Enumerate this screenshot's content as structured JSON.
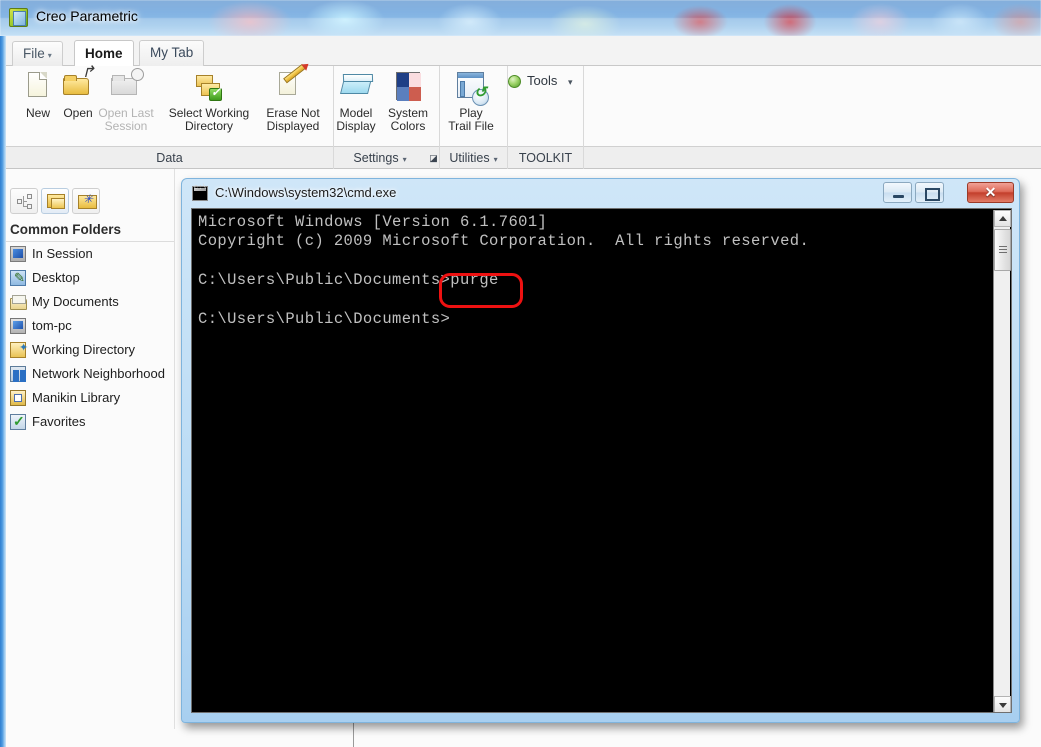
{
  "desktop": {
    "app_window_title": "Creo Parametric",
    "app_icon_name": "creo-app-icon"
  },
  "ribbon": {
    "tabs": [
      {
        "label": "File",
        "caret": "▾",
        "name": "file"
      },
      {
        "label": "Home",
        "name": "home"
      },
      {
        "label": "My Tab",
        "name": "my-tab"
      }
    ],
    "buttons": [
      {
        "label_line1": "New",
        "label_line2": "",
        "icon": "new-document-icon",
        "disabled": false
      },
      {
        "label_line1": "Open",
        "label_line2": "",
        "icon": "open-folder-icon",
        "disabled": false
      },
      {
        "label_line1": "Open Last",
        "label_line2": "Session",
        "icon": "open-last-session-icon",
        "disabled": true
      },
      {
        "label_line1": "Select Working",
        "label_line2": "Directory",
        "icon": "select-working-directory-icon",
        "disabled": false
      },
      {
        "label_line1": "Erase Not",
        "label_line2": "Displayed",
        "icon": "erase-not-displayed-icon",
        "disabled": false
      },
      {
        "label_line1": "Model",
        "label_line2": "Display",
        "icon": "model-display-icon",
        "disabled": false
      },
      {
        "label_line1": "System",
        "label_line2": "Colors",
        "icon": "system-colors-icon",
        "disabled": false
      },
      {
        "label_line1": "Play",
        "label_line2": "Trail File",
        "icon": "play-trail-file-icon",
        "disabled": false
      }
    ],
    "tools_button": {
      "label": "Tools",
      "caret": "▾",
      "icon": "tools-orb-icon"
    },
    "groups": [
      {
        "label": "Data",
        "caret": ""
      },
      {
        "label": "Settings",
        "caret": "▾"
      },
      {
        "label": "Utilities",
        "caret": "▾"
      },
      {
        "label": "TOOLKIT",
        "caret": ""
      }
    ],
    "dialog_launcher": "◪"
  },
  "navigator": {
    "toolbar_buttons": [
      {
        "name": "model-tree-button",
        "icon": "model-tree-icon",
        "active": false
      },
      {
        "name": "folder-browser-button",
        "icon": "folders-icon",
        "active": true
      },
      {
        "name": "favorites-button",
        "icon": "folder-star-icon",
        "active": false
      }
    ],
    "header": "Common Folders",
    "items": [
      {
        "label": "In Session",
        "icon": "in-session-icon"
      },
      {
        "label": "Desktop",
        "icon": "desktop-icon"
      },
      {
        "label": "My Documents",
        "icon": "my-documents-icon"
      },
      {
        "label": "tom-pc",
        "icon": "computer-icon"
      },
      {
        "label": "Working Directory",
        "icon": "working-directory-icon"
      },
      {
        "label": "Network Neighborhood",
        "icon": "network-icon"
      },
      {
        "label": "Manikin Library",
        "icon": "manikin-library-icon"
      },
      {
        "label": "Favorites",
        "icon": "favorites-icon"
      }
    ]
  },
  "cmd_window": {
    "title": "C:\\Windows\\system32\\cmd.exe",
    "icon": "cmd-console-icon",
    "window_buttons": {
      "minimize": "minimize-button",
      "maximize": "maximize-button",
      "close": "close-button"
    },
    "console_text": "Microsoft Windows [Version 6.1.7601]\nCopyright (c) 2009 Microsoft Corporation.  All rights reserved.\n\nC:\\Users\\Public\\Documents>purge\n\nC:\\Users\\Public\\Documents>",
    "scrollbar": {
      "up_arrow": "scroll-up-arrow",
      "down_arrow": "scroll-down-arrow",
      "thumb": "scroll-thumb"
    }
  },
  "annotation": {
    "shape": "rounded-rectangle",
    "color": "#ee1111",
    "targets_text": ">purge"
  }
}
